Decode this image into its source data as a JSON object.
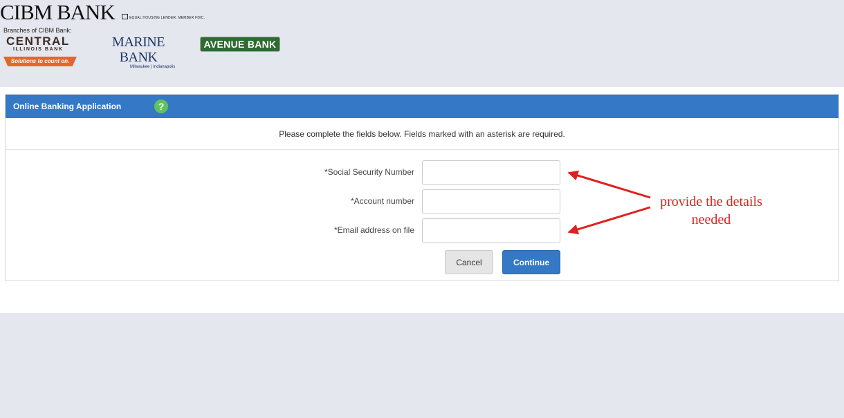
{
  "brand": {
    "name": "CIBM BANK",
    "equal_housing": "EQUAL HOUSING LENDER. MEMBER FDIC.",
    "branches_label": "Branches of CIBM Bank:",
    "central": {
      "name": "CENTRAL",
      "sub": "ILLINOIS BANK",
      "tagline": "Solutions to count on."
    },
    "marine": {
      "name": "MARINE BANK",
      "sub": "Milwaukee | Indianapolis"
    },
    "avenue": {
      "name": "AVENUE BANK"
    }
  },
  "panel": {
    "title": "Online Banking Application",
    "help_icon": "?",
    "instructions": "Please complete the fields below. Fields marked with an asterisk are required.",
    "fields": [
      {
        "label": "*Social Security Number",
        "value": "",
        "placeholder": ""
      },
      {
        "label": "*Account number",
        "value": "",
        "placeholder": ""
      },
      {
        "label": "*Email address on file",
        "value": "",
        "placeholder": ""
      }
    ],
    "buttons": {
      "cancel": "Cancel",
      "continue": "Continue"
    }
  },
  "annotation": {
    "line1": "provide the details",
    "line2": "needed"
  },
  "colors": {
    "accent": "#3478c6",
    "help": "#62c15f",
    "annotation": "#e02020",
    "background": "#e4e7ee",
    "avenue_green": "#2e6b30",
    "central_orange": "#e8652a"
  }
}
